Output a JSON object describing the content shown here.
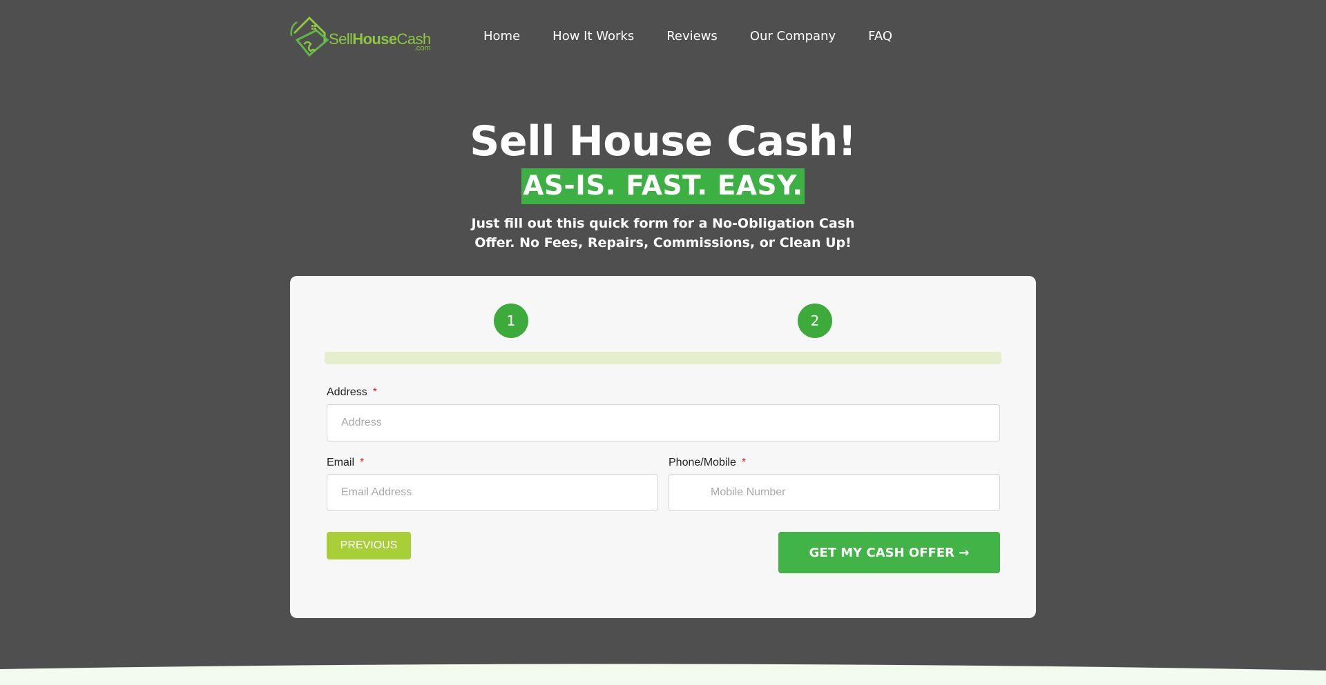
{
  "header": {
    "logo": {
      "text_sell": "Sell",
      "text_house": "House",
      "text_cash": "Cash",
      "text_com": ".com"
    },
    "nav": [
      {
        "label": "Home"
      },
      {
        "label": "How It Works"
      },
      {
        "label": "Reviews"
      },
      {
        "label": "Our Company"
      },
      {
        "label": "FAQ"
      }
    ]
  },
  "hero": {
    "title": "Sell House Cash!",
    "tagline": "AS-IS. FAST. EASY.",
    "subtitle": "Just fill out this quick form for a No-Obligation Cash Offer. No Fees, Repairs, Commissions, or Clean Up!"
  },
  "form": {
    "steps": [
      "1",
      "2"
    ],
    "progress": 1.0,
    "address": {
      "label": "Address",
      "required": "*",
      "placeholder": "Address"
    },
    "email": {
      "label": "Email",
      "required": "*",
      "placeholder": "Email Address"
    },
    "phone": {
      "label": "Phone/Mobile",
      "required": "*",
      "placeholder": "Mobile Number"
    },
    "previous_label": "PREVIOUS",
    "submit_label": "GET MY CASH OFFER →"
  },
  "colors": {
    "background": "#4f4f4f",
    "accent_green": "#3cb043",
    "lime": "#a8cf37",
    "card": "#f7f7f7"
  }
}
